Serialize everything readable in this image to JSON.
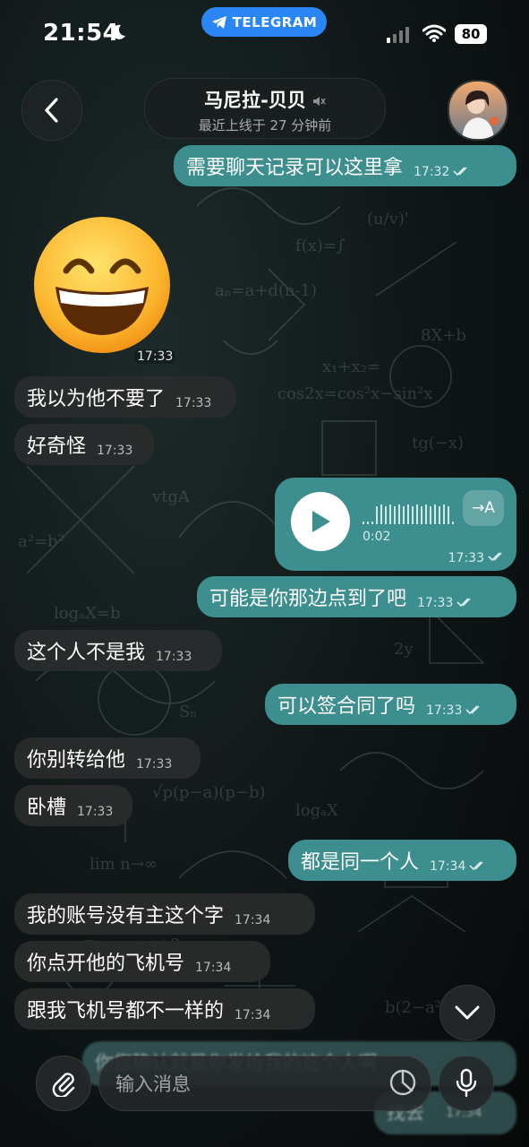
{
  "status_bar": {
    "time": "21:54",
    "app_pill": "TELEGRAM",
    "battery": "80"
  },
  "header": {
    "title": "马尼拉-贝贝",
    "subtitle": "最近上线于 27 分钟前"
  },
  "messages": [
    {
      "id": "m1",
      "dir": "out",
      "text": "需要聊天记录可以这里拿",
      "time": "17:32"
    },
    {
      "id": "m2",
      "dir": "in",
      "type": "sticker",
      "sticker": "grinning-face-emoji",
      "time": "17:33"
    },
    {
      "id": "m3",
      "dir": "in",
      "text": "我以为他不要了",
      "time": "17:33"
    },
    {
      "id": "m4",
      "dir": "in",
      "text": "好奇怪",
      "time": "17:33"
    },
    {
      "id": "m5",
      "dir": "out",
      "type": "voice",
      "duration": "0:02",
      "transcribe_label": "→A",
      "time": "17:33"
    },
    {
      "id": "m6",
      "dir": "out",
      "text": "可能是你那边点到了吧",
      "time": "17:33"
    },
    {
      "id": "m7",
      "dir": "in",
      "text": "这个人不是我",
      "time": "17:33"
    },
    {
      "id": "m8",
      "dir": "out",
      "text": "可以签合同了吗",
      "time": "17:33"
    },
    {
      "id": "m9",
      "dir": "in",
      "text": "你别转给他",
      "time": "17:33"
    },
    {
      "id": "m10",
      "dir": "in",
      "text": "卧槽",
      "time": "17:33"
    },
    {
      "id": "m11",
      "dir": "out",
      "text": "都是同一个人",
      "time": "17:34"
    },
    {
      "id": "m12",
      "dir": "in",
      "text": "我的账号没有主这个字",
      "time": "17:34"
    },
    {
      "id": "m13",
      "dir": "in",
      "text": "你点开他的飞机号",
      "time": "17:34"
    },
    {
      "id": "m14",
      "dir": "in",
      "text": "跟我飞机号都不一样的",
      "time": "17:34"
    }
  ],
  "obscured": [
    {
      "text": "你您确认就是你发给我的这个人啊"
    },
    {
      "text": "找去",
      "time": "17:34"
    }
  ],
  "input": {
    "placeholder": "输入消息"
  },
  "colors": {
    "outgoing_bubble": "#3d8e8f",
    "incoming_bubble": "#2a2c2c",
    "accent": "#2a86f5"
  },
  "icons": [
    "back-chevron-icon",
    "mute-icon",
    "play-icon",
    "attach-icon",
    "sticker-icon",
    "mic-icon",
    "chevron-down-icon",
    "read-check-icon"
  ]
}
